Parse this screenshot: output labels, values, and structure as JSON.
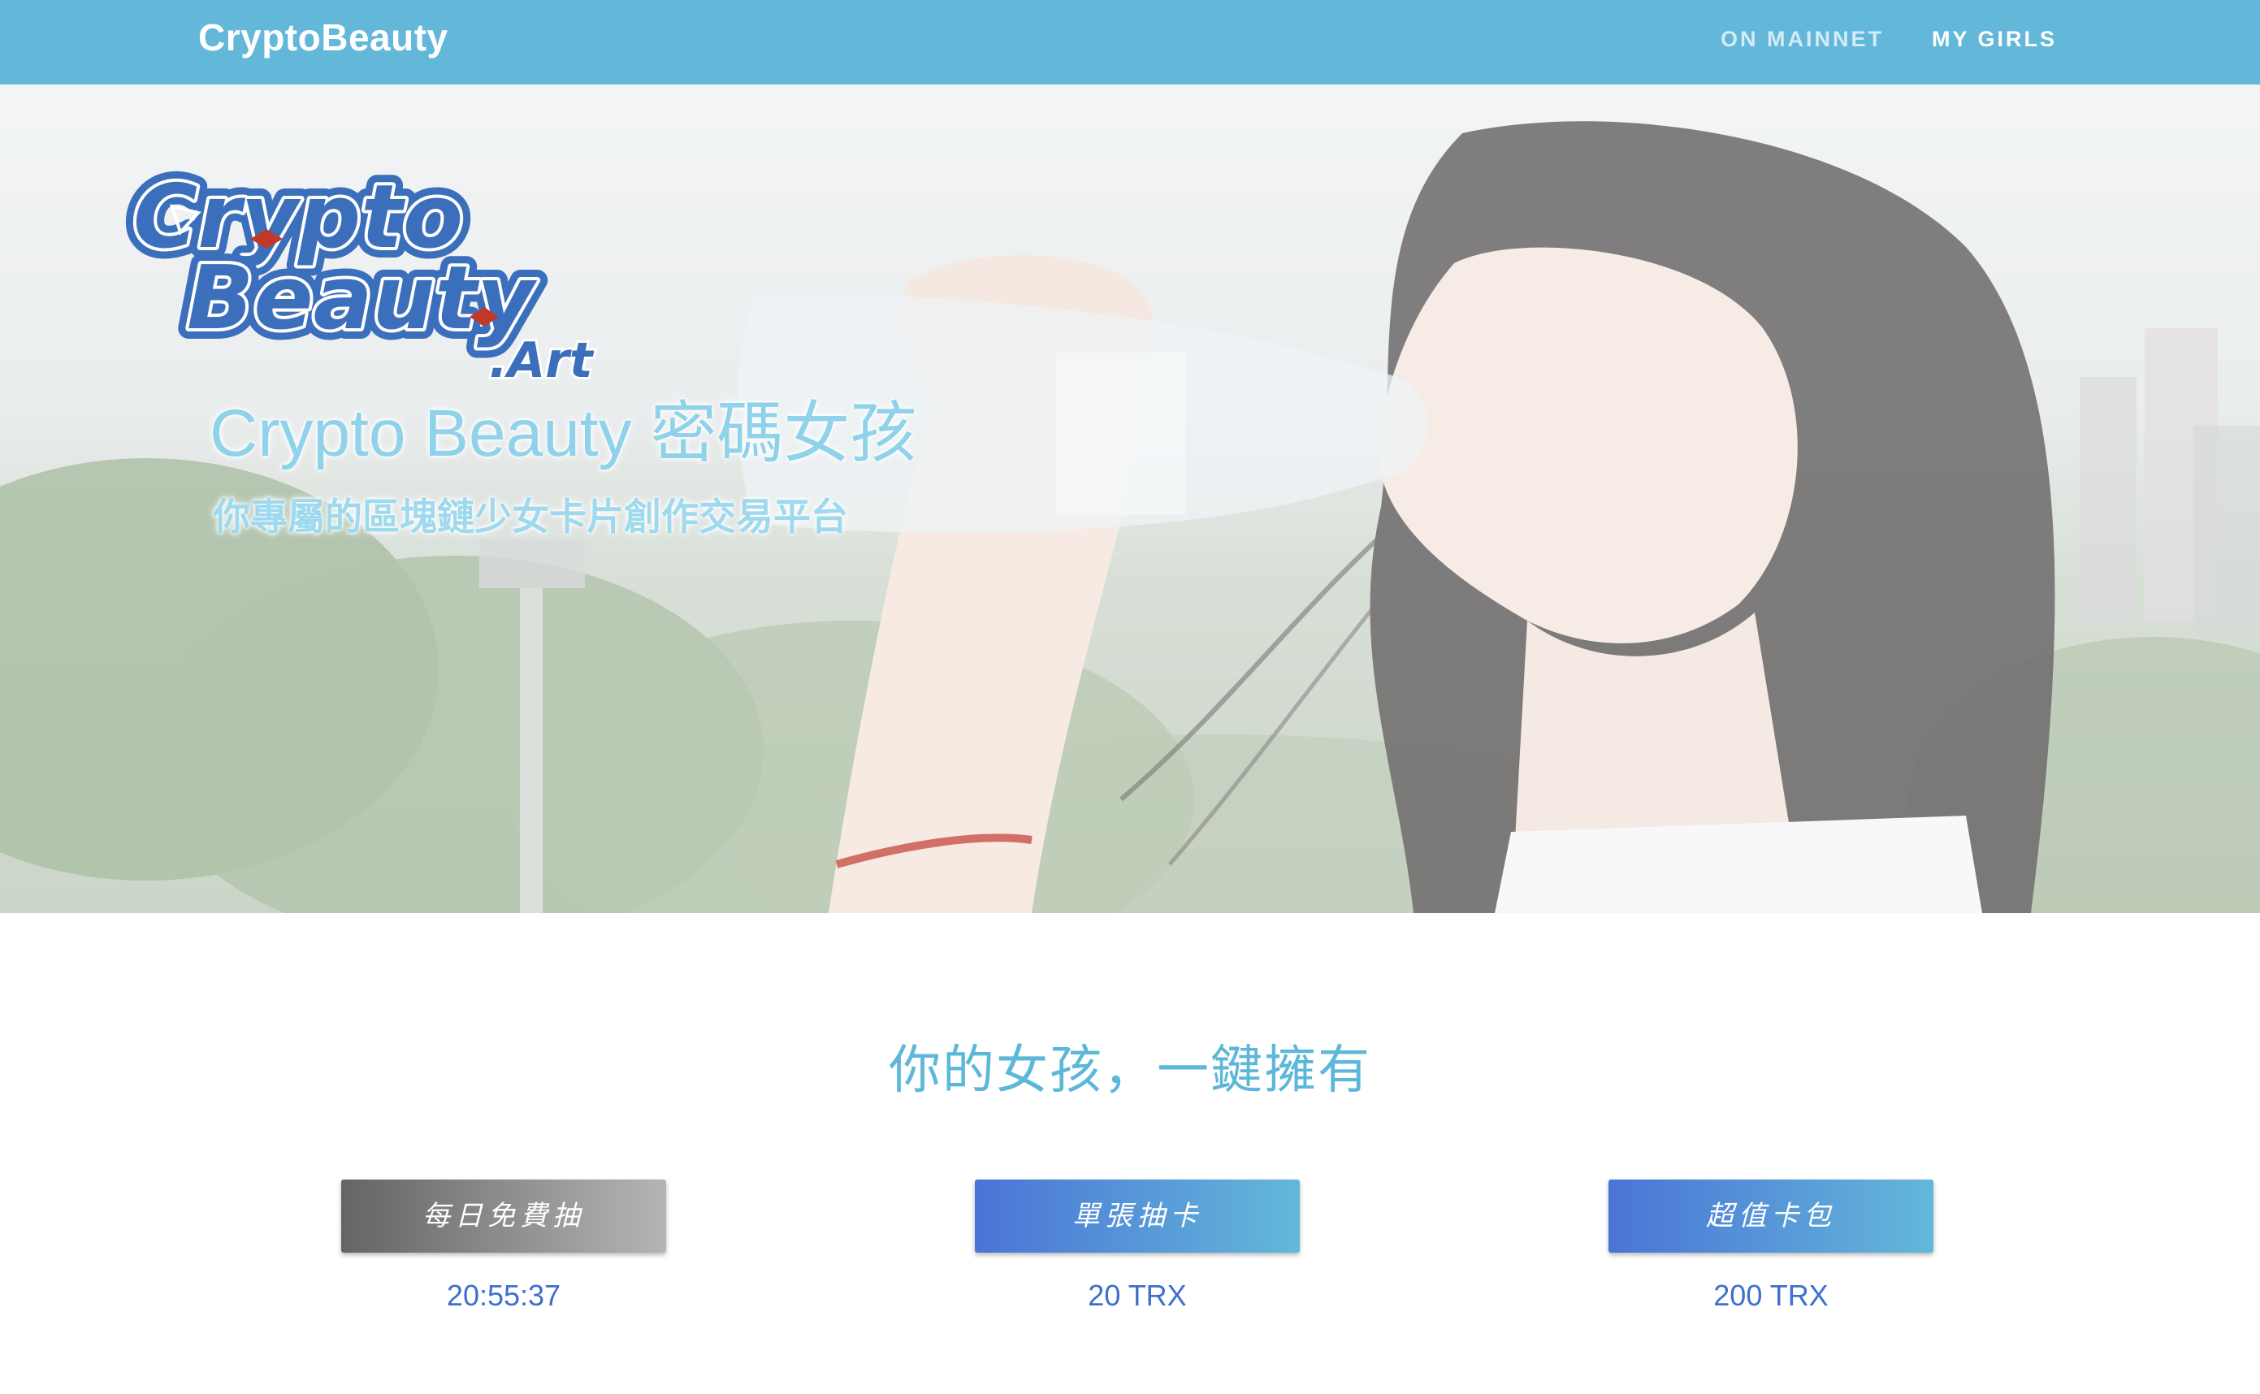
{
  "navbar": {
    "brand": "CryptoBeauty",
    "links": [
      {
        "label": "ON MAINNET"
      },
      {
        "label": "MY GIRLS"
      }
    ],
    "background_color": "#63b8da"
  },
  "hero": {
    "logo": {
      "line1": "Crypto",
      "line2": "Beauty",
      "suffix": ".Art"
    },
    "title": "Crypto Beauty 密碼女孩",
    "subtitle": "你專屬的區塊鏈少女卡片創作交易平台",
    "image_description_icon": "hero-photo"
  },
  "main": {
    "heading": "你的女孩，一鍵擁有",
    "cards": [
      {
        "button_label": "每日免費抽",
        "value": "20:55:37"
      },
      {
        "button_label": "單張抽卡",
        "value": "20 TRX"
      },
      {
        "button_label": "超值卡包",
        "value": "200 TRX"
      }
    ]
  },
  "colors": {
    "accent": "#5cb7d9",
    "price_blue": "#3e6fcf",
    "button_gradient_start": "#4a74d6",
    "button_gradient_end": "#63b8da"
  }
}
